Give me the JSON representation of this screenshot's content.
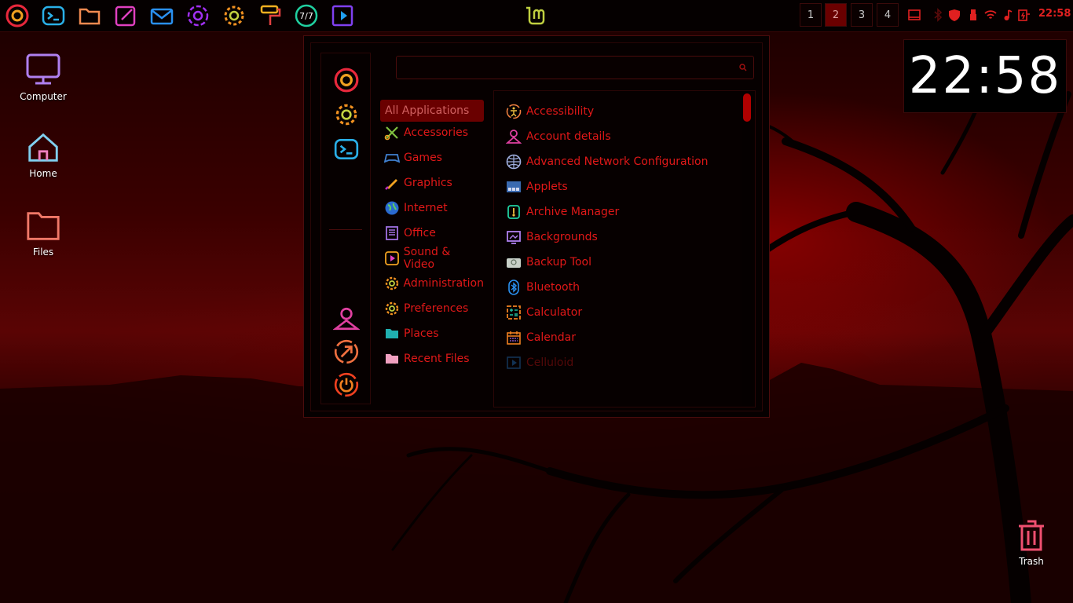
{
  "panel": {
    "launchers": [
      "firefox-icon",
      "terminal-icon",
      "files-icon",
      "text-editor-icon",
      "mail-icon",
      "settings-ring-icon",
      "gear-icon",
      "paint-roller-icon",
      "speedometer-icon",
      "media-icon"
    ],
    "workspaces": [
      "1",
      "2",
      "3",
      "4"
    ],
    "active_workspace": 1,
    "clock": "22:58"
  },
  "desktop": {
    "computer_label": "Computer",
    "home_label": "Home",
    "files_label": "Files",
    "trash_label": "Trash"
  },
  "desklet": {
    "time": "22:58"
  },
  "menu": {
    "search": {
      "placeholder": "",
      "value": ""
    },
    "categories": [
      {
        "label": "All Applications",
        "icon": "all-icon"
      },
      {
        "label": "Accessories",
        "icon": "accessories-icon"
      },
      {
        "label": "Games",
        "icon": "gamepad-icon"
      },
      {
        "label": "Graphics",
        "icon": "graphics-icon"
      },
      {
        "label": "Internet",
        "icon": "globe-icon"
      },
      {
        "label": "Office",
        "icon": "office-icon"
      },
      {
        "label": "Sound & Video",
        "icon": "media-icon"
      },
      {
        "label": "Administration",
        "icon": "gear-icon"
      },
      {
        "label": "Preferences",
        "icon": "gear-icon"
      },
      {
        "label": "Places",
        "icon": "folder-icon"
      },
      {
        "label": "Recent Files",
        "icon": "folder-icon"
      }
    ],
    "apps": [
      {
        "label": "Accessibility",
        "icon": "accessibility-icon"
      },
      {
        "label": "Account details",
        "icon": "user-icon"
      },
      {
        "label": "Advanced Network Configuration",
        "icon": "network-icon"
      },
      {
        "label": "Applets",
        "icon": "applets-icon"
      },
      {
        "label": "Archive Manager",
        "icon": "archive-icon"
      },
      {
        "label": "Backgrounds",
        "icon": "backgrounds-icon"
      },
      {
        "label": "Backup Tool",
        "icon": "backup-icon"
      },
      {
        "label": "Bluetooth",
        "icon": "bluetooth-icon"
      },
      {
        "label": "Calculator",
        "icon": "calculator-icon"
      },
      {
        "label": "Calendar",
        "icon": "calendar-icon"
      },
      {
        "label": "Celluloid",
        "icon": "video-icon"
      }
    ]
  },
  "colors": {
    "accent": "#e01818",
    "selected": "#6a0000",
    "background": "#060000"
  }
}
